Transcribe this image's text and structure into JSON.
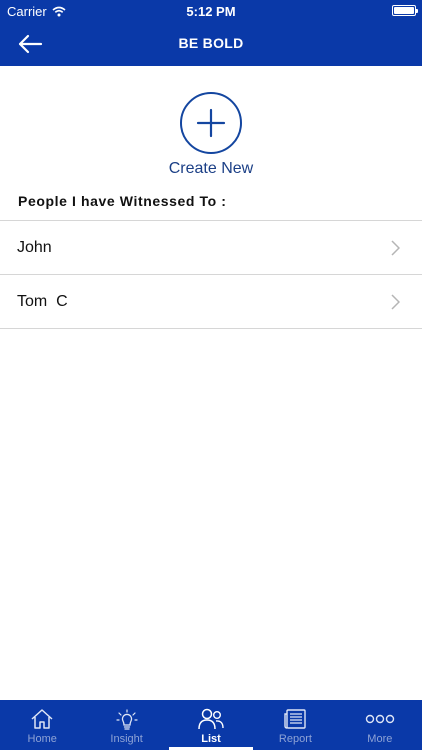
{
  "status_bar": {
    "carrier": "Carrier",
    "time": "5:12 PM"
  },
  "nav": {
    "title": "BE BOLD"
  },
  "create": {
    "label": "Create New"
  },
  "section": {
    "title": "People I have Witnessed To :"
  },
  "people": [
    {
      "name": "John"
    },
    {
      "name": "Tom  C"
    }
  ],
  "tabs": [
    {
      "label": "Home",
      "icon": "home-icon"
    },
    {
      "label": "Insight",
      "icon": "lightbulb-icon"
    },
    {
      "label": "List",
      "icon": "people-icon",
      "active": true
    },
    {
      "label": "Report",
      "icon": "newspaper-icon"
    },
    {
      "label": "More",
      "icon": "more-icon"
    }
  ],
  "colors": {
    "brand": "#0a39a8",
    "accent": "#1446a0",
    "tab_inactive": "#8ea3d6"
  }
}
